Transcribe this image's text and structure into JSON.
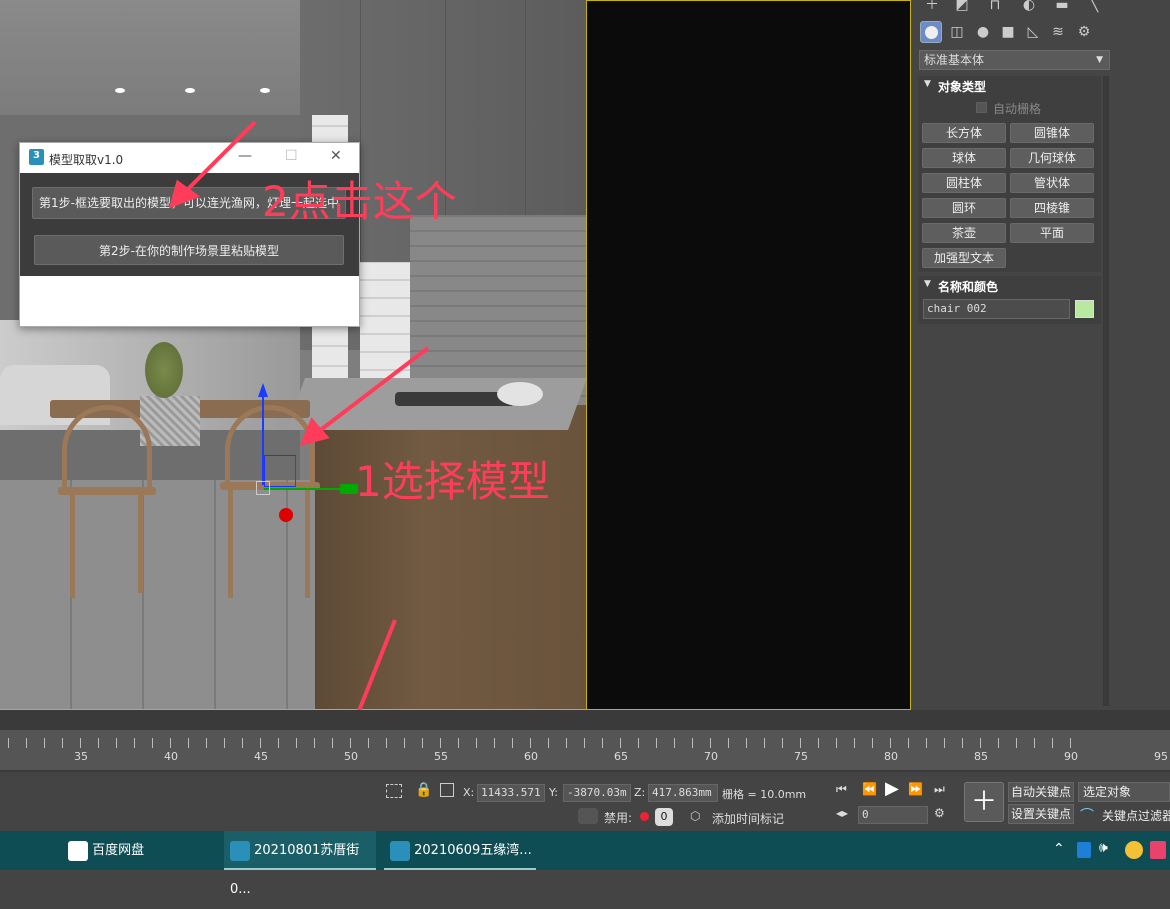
{
  "dialog": {
    "title": "模型取取v1.0",
    "step1": "第1步-框选要取出的模型，可以连光渔网，灯理一起选中",
    "step2": "第2步-在你的制作场景里粘贴模型",
    "min": "—",
    "max": "☐",
    "close": "✕"
  },
  "annotations": {
    "click_this": "2点击这个",
    "select_model": "1选择模型"
  },
  "command_panel": {
    "dropdown": "标准基本体",
    "section_object_type": "对象类型",
    "auto_grid": "自动栅格",
    "buttons": [
      "长方体",
      "圆锥体",
      "球体",
      "几何球体",
      "圆柱体",
      "管状体",
      "圆环",
      "四棱锥",
      "茶壶",
      "平面",
      "加强型文本"
    ],
    "section_name_color": "名称和颜色",
    "object_name": "chair 002",
    "object_color": "#b7eaa0"
  },
  "timeline": {
    "ticks": [
      "35",
      "40",
      "45",
      "50",
      "55",
      "60",
      "65",
      "70",
      "75",
      "80",
      "85",
      "90",
      "95"
    ]
  },
  "status": {
    "x_label": "X:",
    "x_value": "11433.571",
    "y_label": "Y:",
    "y_value": "-3870.03m",
    "z_label": "Z:",
    "z_value": "417.863mm",
    "grid": "栅格 = 10.0mm",
    "disabled": "禁用:",
    "add_time_tag": "添加时间标记",
    "frame_value": "0",
    "auto_key": "自动关键点",
    "set_key": "设置关键点",
    "selected_object": "选定对象",
    "key_filter": "关键点过滤器"
  },
  "taskbar": {
    "items": [
      "百度网盘",
      "20210801苏厝街0...",
      "20210609五缘湾..."
    ]
  }
}
